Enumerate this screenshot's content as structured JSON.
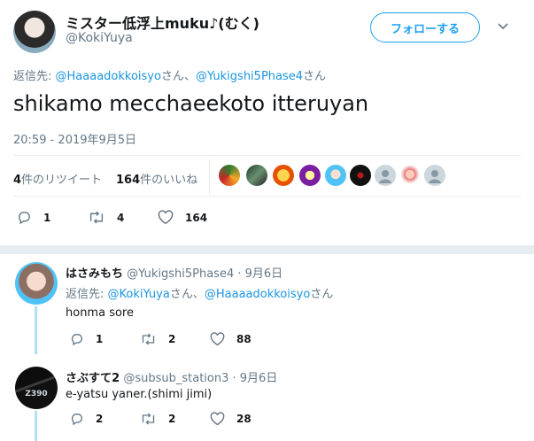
{
  "colors": {
    "accent": "#1da1f2",
    "link": "#1b95e0",
    "muted": "#657786",
    "thread": "#aee1f9",
    "divider": "#e6ecf0"
  },
  "main_tweet": {
    "author_name": "ミスター低浮上muku♪(むく)",
    "author_handle": "@KokiYuya",
    "follow_label": "フォローする",
    "reply_prefix": "返信先: ",
    "reply_to_1": "@Haaaadokkoisyo",
    "reply_sep": "さん、",
    "reply_to_2": "@Yukigshi5Phase4",
    "reply_suffix": "さん",
    "text": "shikamo mecchaeekoto itteruyan",
    "timestamp": "20:59 - 2019年9月5日",
    "retweet_count": "4",
    "retweet_label": "件のリツイート",
    "like_count": "164",
    "like_label": "件のいいね",
    "actions": {
      "replies": "1",
      "retweets": "4",
      "likes": "164"
    },
    "liker_avatars": [
      "avatar-1",
      "avatar-2",
      "avatar-3",
      "avatar-4",
      "avatar-5",
      "avatar-6",
      "avatar-7",
      "avatar-8",
      "avatar-9"
    ]
  },
  "replies": [
    {
      "name": "はさみもち",
      "handle": "@Yukigshi5Phase4",
      "date": "· 9月6日",
      "reply_prefix": "返信先: ",
      "reply_to_1": "@KokiYuya",
      "reply_sep": "さん、",
      "reply_to_2": "@Haaaadokkoisyo",
      "reply_suffix": "さん",
      "text": "honma sore",
      "replies": "1",
      "retweets": "2",
      "likes": "88"
    },
    {
      "name": "さぶすて2",
      "handle": "@subsub_station3",
      "date": "· 9月6日",
      "text": "e-yatsu yaner.(shimi jimi)",
      "avatar_text": "Z390",
      "replies": "2",
      "retweets": "2",
      "likes": "28"
    }
  ],
  "icons": {
    "more": "chevron-down-icon",
    "reply": "reply-icon",
    "retweet": "retweet-icon",
    "like": "heart-icon"
  }
}
